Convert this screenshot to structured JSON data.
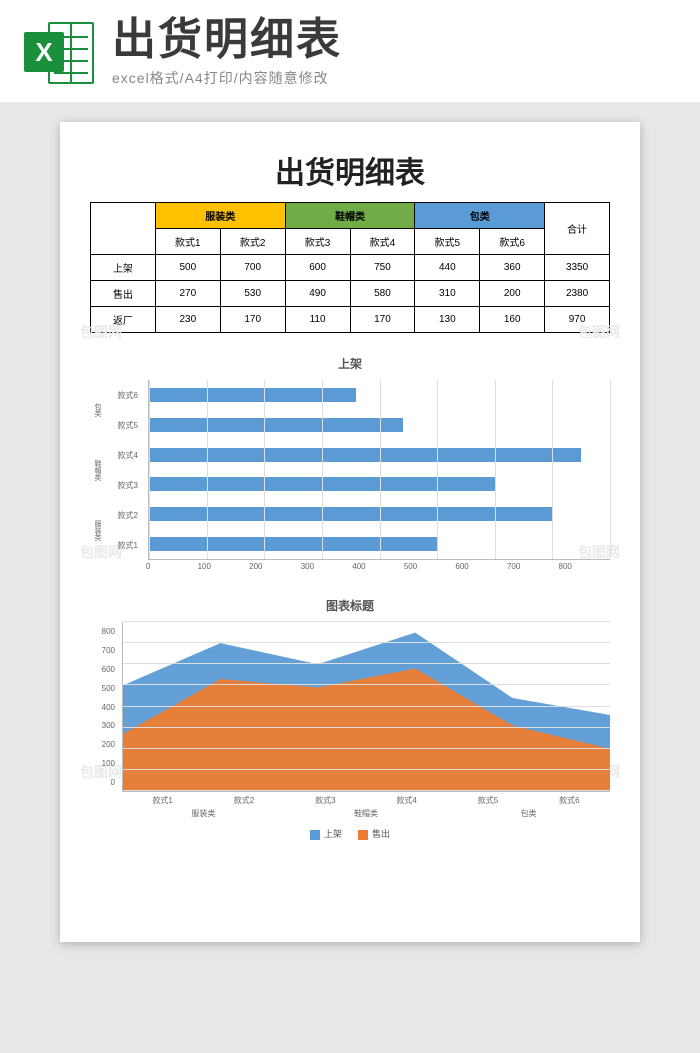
{
  "header": {
    "icon_letter": "X",
    "title": "出货明细表",
    "subtitle": "excel格式/A4打印/内容随意修改"
  },
  "doc": {
    "title": "出货明细表",
    "categories": [
      {
        "name": "服装类",
        "styles": [
          "款式1",
          "款式2"
        ]
      },
      {
        "name": "鞋帽类",
        "styles": [
          "款式3",
          "款式4"
        ]
      },
      {
        "name": "包类",
        "styles": [
          "款式5",
          "款式6"
        ]
      }
    ],
    "total_label": "合计",
    "rows": [
      {
        "label": "上架",
        "values": [
          500,
          700,
          600,
          750,
          440,
          360
        ],
        "total": 3350
      },
      {
        "label": "售出",
        "values": [
          270,
          530,
          490,
          580,
          310,
          200
        ],
        "total": 2380
      },
      {
        "label": "返厂",
        "values": [
          230,
          170,
          110,
          170,
          130,
          160
        ],
        "total": 970
      }
    ]
  },
  "chart_data": [
    {
      "type": "bar",
      "orientation": "horizontal",
      "title": "上架",
      "categories": [
        "款式1",
        "款式2",
        "款式3",
        "款式4",
        "款式5",
        "款式6"
      ],
      "category_groups": [
        "服装类",
        "服装类",
        "鞋帽类",
        "鞋帽类",
        "包类",
        "包类"
      ],
      "values": [
        500,
        700,
        600,
        750,
        440,
        360
      ],
      "xlim": [
        0,
        800
      ],
      "xticks": [
        0,
        100,
        200,
        300,
        400,
        500,
        600,
        700,
        800
      ],
      "color": "#5b9bd5"
    },
    {
      "type": "area",
      "title": "图表标题",
      "x": [
        "款式1",
        "款式2",
        "款式3",
        "款式4",
        "款式5",
        "款式6"
      ],
      "x_groups": [
        "服装类",
        "鞋帽类",
        "包类"
      ],
      "series": [
        {
          "name": "上架",
          "values": [
            500,
            700,
            600,
            750,
            440,
            360
          ],
          "color": "#5b9bd5"
        },
        {
          "name": "售出",
          "values": [
            270,
            530,
            490,
            580,
            310,
            200
          ],
          "color": "#ed7d31"
        }
      ],
      "ylim": [
        0,
        800
      ],
      "yticks": [
        0,
        100,
        200,
        300,
        400,
        500,
        600,
        700,
        800
      ]
    }
  ],
  "watermark": "包图网"
}
